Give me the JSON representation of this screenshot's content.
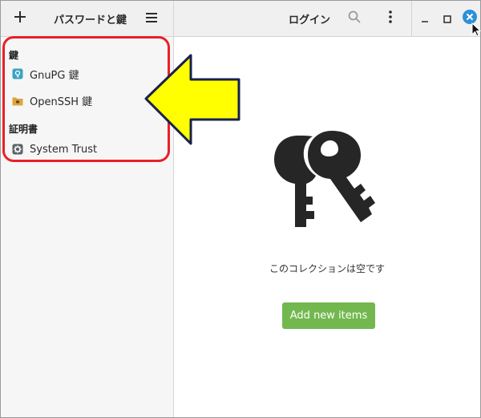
{
  "header": {
    "sidebar_title": "パスワードと鍵",
    "main_title": "ログイン",
    "add_icon": "plus-icon",
    "menu_icon": "hamburger-icon",
    "search_icon": "search-icon",
    "more_icon": "kebab-icon",
    "minimize_icon": "minimize-icon",
    "maximize_icon": "maximize-icon",
    "close_icon": "close-icon"
  },
  "sidebar": {
    "sections": [
      {
        "title": "鍵",
        "items": [
          {
            "label": "GnuPG 鍵",
            "icon": "gnupg-keyring-icon"
          },
          {
            "label": "OpenSSH 鍵",
            "icon": "folder-icon"
          }
        ]
      },
      {
        "title": "証明書",
        "items": [
          {
            "label": "System Trust",
            "icon": "gear-icon"
          }
        ]
      }
    ]
  },
  "main": {
    "empty_icon": "keys-icon",
    "empty_message": "このコレクションは空です",
    "add_button_label": "Add new items"
  },
  "colors": {
    "accent_green": "#72b84f",
    "close_blue": "#2f8fd8",
    "annotation_red": "#e8202a",
    "annotation_yellow": "#ffff00"
  },
  "annotation": {
    "highlight": "red-rounded-rectangle",
    "pointer": "yellow-arrow"
  }
}
